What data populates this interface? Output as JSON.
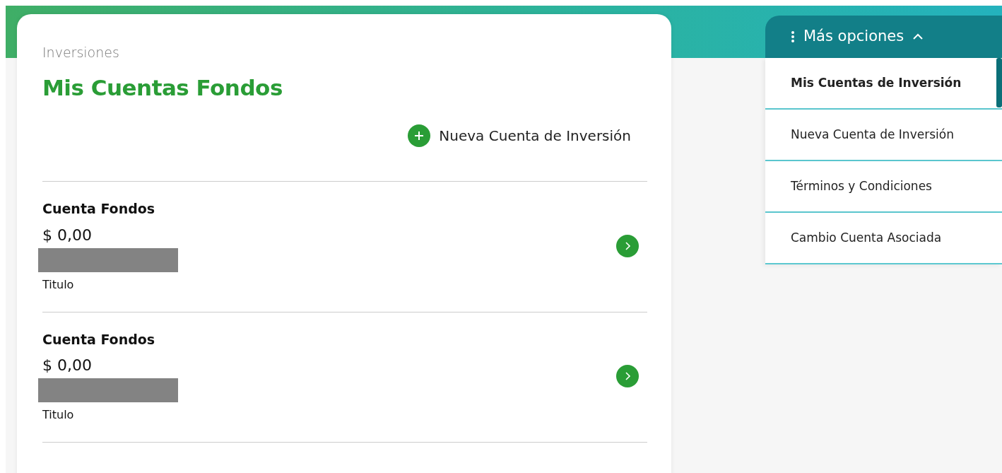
{
  "breadcrumb": "Inversiones",
  "title": "Mis Cuentas Fondos",
  "new_account_link": "Nueva Cuenta de Inversión",
  "accounts": [
    {
      "name": "Cuenta Fondos",
      "balance": "$ 0,00",
      "subtitle": "Titulo"
    },
    {
      "name": "Cuenta Fondos",
      "balance": "$ 0,00",
      "subtitle": "Titulo"
    }
  ],
  "more_options": {
    "label": "Más opciones",
    "expanded": true,
    "items": [
      {
        "label": "Mis Cuentas de Inversión",
        "selected": true
      },
      {
        "label": "Nueva Cuenta de Inversión",
        "selected": false
      },
      {
        "label": "Términos y Condiciones",
        "selected": false
      },
      {
        "label": "Cambio Cuenta Asociada",
        "selected": false
      }
    ]
  }
}
